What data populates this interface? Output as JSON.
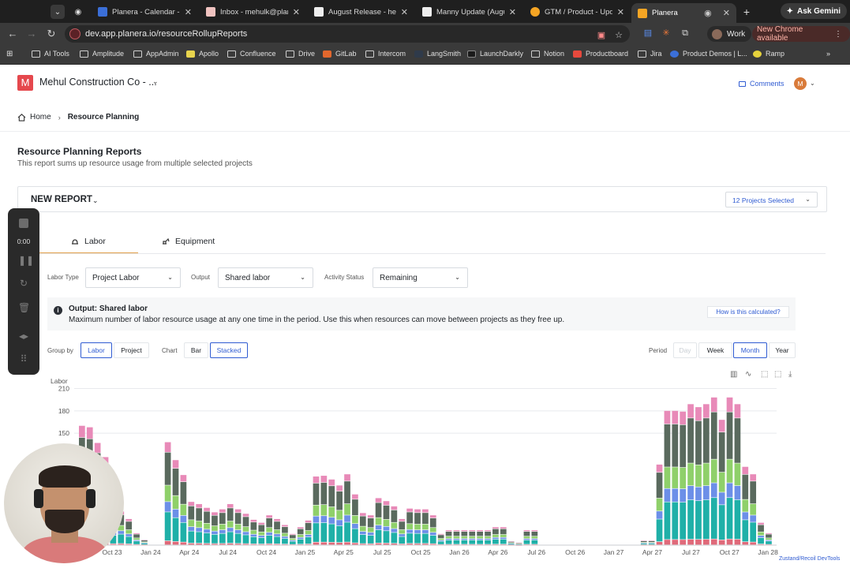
{
  "browser": {
    "tabs": [
      {
        "title": "Planera - Calendar - W",
        "fav": "#3b6fd8"
      },
      {
        "title": "Inbox - mehulk@planer",
        "fav": "#f0c3c0"
      },
      {
        "title": "August Release - head",
        "fav": "#eeeeee"
      },
      {
        "title": "Manny Update (Augus",
        "fav": "#eeeeee"
      },
      {
        "title": "GTM / Product - Upda",
        "fav": "#f5a524"
      },
      {
        "title": "Planera",
        "fav": "#f5a524"
      }
    ],
    "ask_gemini": "Ask Gemini",
    "url": "dev.app.planera.io/resourceRollupReports",
    "profile": "Work",
    "update_notice": "New Chrome available",
    "bookmarks": [
      "AI Tools",
      "Amplitude",
      "AppAdmin",
      "Apollo",
      "Confluence",
      "Drive",
      "GitLab",
      "Intercom",
      "LangSmith",
      "LaunchDarkly",
      "Notion",
      "Productboard",
      "Jira",
      "Product Demos | L...",
      "Ramp"
    ],
    "more_chevron": "»"
  },
  "app": {
    "logo_letter": "M",
    "company": "Mehul Construction Co - ...",
    "comments": "Comments",
    "user_initial": "M",
    "breadcrumb": {
      "home": "Home",
      "current": "Resource Planning"
    },
    "report_title": "Resource Planning Reports",
    "report_subtitle": "This report sums up resource usage from multiple selected projects",
    "report_name": "NEW REPORT",
    "projects_selected": "12 Projects Selected",
    "tabs": [
      {
        "label": "Labor"
      },
      {
        "label": "Equipment"
      }
    ],
    "filters": {
      "labor_type_label": "Labor Type",
      "labor_type_value": "Project Labor",
      "output_label": "Output",
      "output_value": "Shared labor",
      "activity_label": "Activity Status",
      "activity_value": "Remaining"
    },
    "info": {
      "title": "Output: Shared labor",
      "text": "Maximum number of labor resource usage at any one time in the period. Use this when resources can move between projects as they free up.",
      "button": "How is this calculated?"
    },
    "group_by": {
      "label": "Group by",
      "options": [
        "Labor",
        "Project"
      ],
      "selected": "Labor"
    },
    "chart_type": {
      "label": "Chart",
      "options": [
        "Bar",
        "Stacked"
      ],
      "selected": "Stacked"
    },
    "period": {
      "label": "Period",
      "options": [
        "Day",
        "Week",
        "Month",
        "Year"
      ],
      "selected": "Month",
      "disabled": "Day"
    },
    "devtools": "Zustand/Recoil DevTools"
  },
  "recorder": {
    "timer": "0:00"
  },
  "chart_data": {
    "type": "bar",
    "stacked": true,
    "ylabel": "Labor",
    "yticks": [
      150,
      180,
      210
    ],
    "ylim": [
      0,
      220
    ],
    "x_tick_labels": [
      "Oct 23",
      "Jan 24",
      "Apr 24",
      "Jul 24",
      "Oct 24",
      "Jan 25",
      "Apr 25",
      "Jul 25",
      "Oct 25",
      "Jan 26",
      "Apr 26",
      "Jul 26",
      "Oct 26",
      "Jan 27",
      "Apr 27",
      "Jul 27",
      "Oct 27",
      "Jan 28"
    ],
    "bar_colors": [
      "#e06a7a",
      "#1fb0a8",
      "#6c8fe8",
      "#8fd06a",
      "#5a6a5e",
      "#e88ab8"
    ],
    "totals": [
      160,
      158,
      137,
      118,
      40,
      45,
      35,
      16,
      7,
      0,
      0,
      138,
      114,
      94,
      58,
      55,
      50,
      44,
      48,
      55,
      48,
      42,
      34,
      30,
      40,
      35,
      27,
      15,
      24,
      33,
      92,
      93,
      88,
      80,
      95,
      68,
      43,
      40,
      63,
      59,
      52,
      35,
      49,
      48,
      48,
      40,
      15,
      20,
      20,
      20,
      20,
      20,
      20,
      24,
      24,
      5,
      3,
      20,
      20,
      0,
      0,
      0,
      0,
      0,
      0,
      0,
      0,
      0,
      0,
      0,
      0,
      0,
      6,
      6,
      108,
      180,
      180,
      179,
      189,
      185,
      189,
      198,
      168,
      198,
      189,
      105,
      95,
      30,
      16
    ]
  }
}
